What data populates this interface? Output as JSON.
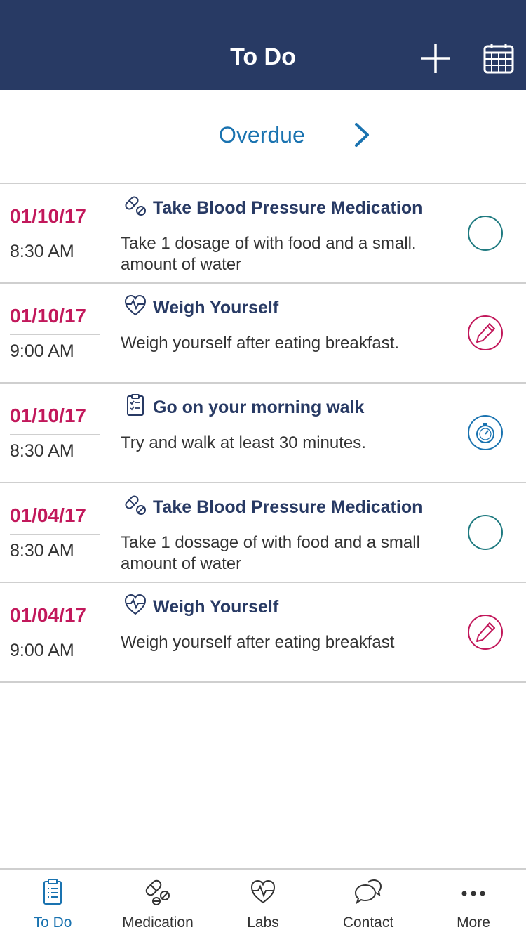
{
  "header": {
    "title": "To Do",
    "add_icon": "plus-icon",
    "calendar_icon": "calendar-icon"
  },
  "overdue": {
    "label": "Overdue",
    "icon": "chevron-right-icon"
  },
  "tasks": [
    {
      "date": "01/10/17",
      "time": "8:30 AM",
      "icon": "pills-icon",
      "title": "Take Blood Pressure Medication",
      "description": "Take 1 dosage of with food and a small. amount of water",
      "action_icon": "empty-circle-icon"
    },
    {
      "date": "01/10/17",
      "time": "9:00 AM",
      "icon": "heart-pulse-icon",
      "title": "Weigh Yourself",
      "description": "Weigh yourself after eating breakfast.",
      "action_icon": "pencil-circle-icon"
    },
    {
      "date": "01/10/17",
      "time": "8:30 AM",
      "icon": "checklist-icon",
      "title": "Go on your morning walk",
      "description": "Try and walk at least 30 minutes.",
      "action_icon": "stopwatch-icon"
    },
    {
      "date": "01/04/17",
      "time": "8:30 AM",
      "icon": "pills-icon",
      "title": "Take Blood Pressure Medication",
      "description": "Take 1 dossage of with food and a small amount of water",
      "action_icon": "empty-circle-icon"
    },
    {
      "date": "01/04/17",
      "time": "9:00 AM",
      "icon": "heart-pulse-icon",
      "title": "Weigh Yourself",
      "description": "Weigh yourself after eating breakfast",
      "action_icon": "pencil-circle-icon"
    }
  ],
  "tabbar": {
    "tabs": [
      {
        "label": "To Do",
        "icon": "clipboard-icon",
        "active": true
      },
      {
        "label": "Medication",
        "icon": "pills-icon",
        "active": false
      },
      {
        "label": "Labs",
        "icon": "heart-pulse-icon",
        "active": false
      },
      {
        "label": "Contact",
        "icon": "chat-bubbles-icon",
        "active": false
      },
      {
        "label": "More",
        "icon": "more-dots-icon",
        "active": false
      }
    ]
  },
  "colors": {
    "header_bg": "#283a64",
    "accent_blue": "#1a73b0",
    "date_pink": "#c2185b",
    "circle_teal": "#1f7a80",
    "title_navy": "#283a64"
  }
}
